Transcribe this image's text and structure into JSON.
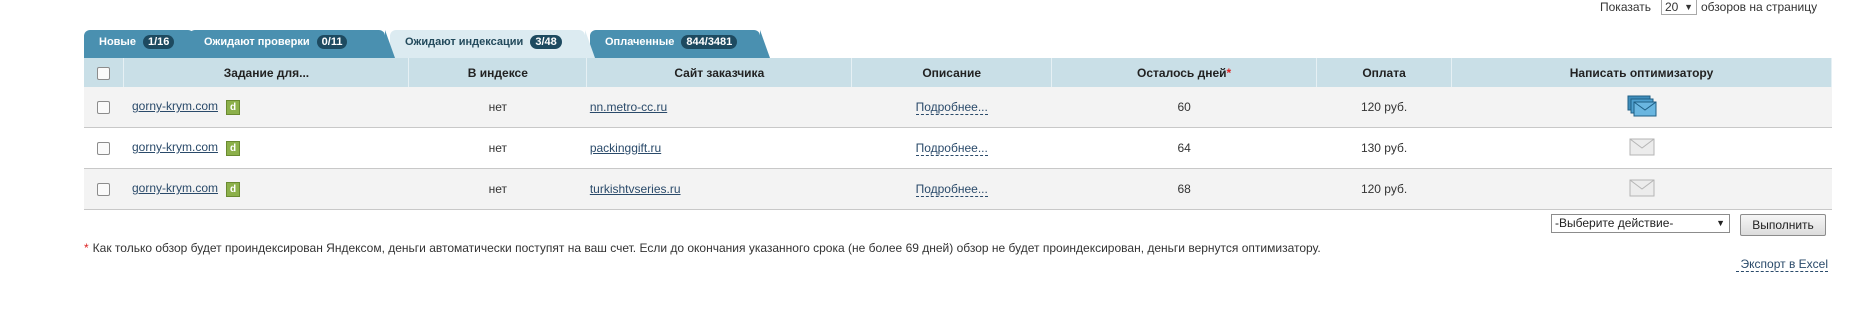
{
  "per_page": {
    "label_before": "Показать",
    "selected": "20",
    "label_after": "обзоров на страницу"
  },
  "tabs": [
    {
      "label": "Новые",
      "count": "1/16",
      "active": false
    },
    {
      "label": "Ожидают проверки",
      "count": "0/11",
      "active": false
    },
    {
      "label": "Ожидают индексации",
      "count": "3/48",
      "active": true
    },
    {
      "label": "Оплаченные",
      "count": "844/3481",
      "active": false
    }
  ],
  "table": {
    "headers": {
      "task": "Задание для...",
      "indexed": "В индексе",
      "site": "Сайт заказчика",
      "description": "Описание",
      "days_left": "Осталось дней",
      "days_left_mark": "*",
      "payment": "Оплата",
      "contact": "Написать оптимизатору"
    },
    "rows": [
      {
        "task": "gorny-krym.com",
        "badge": "d",
        "indexed": "нет",
        "site": "nn.metro-cc.ru",
        "description": "Подробнее...",
        "days_left": "60",
        "payment": "120 руб.",
        "contact_icon": "envelopes-stack-icon"
      },
      {
        "task": "gorny-krym.com",
        "badge": "d",
        "indexed": "нет",
        "site": "packinggift.ru",
        "description": "Подробнее...",
        "days_left": "64",
        "payment": "130 руб.",
        "contact_icon": "envelope-icon"
      },
      {
        "task": "gorny-krym.com",
        "badge": "d",
        "indexed": "нет",
        "site": "turkishtvseries.ru",
        "description": "Подробнее...",
        "days_left": "68",
        "payment": "120 руб.",
        "contact_icon": "envelope-icon"
      }
    ]
  },
  "actions": {
    "select_value": "-Выберите действие-",
    "execute_label": "Выполнить"
  },
  "footnote": {
    "mark": "*",
    "text": "Как только обзор будет проиндексирован Яндексом, деньги автоматически поступят на ваш счет. Если до окончания указанного срока (не более 69 дней) обзор не будет проиндексирован, деньги вернутся оптимизатору."
  },
  "export_label": "Экспорт в Excel",
  "colors": {
    "tab": "#4a90b0",
    "tab_active": "#dcebf1",
    "header": "#c9dfe7",
    "link": "#2a4a6a",
    "badge": "#8cb04a"
  }
}
